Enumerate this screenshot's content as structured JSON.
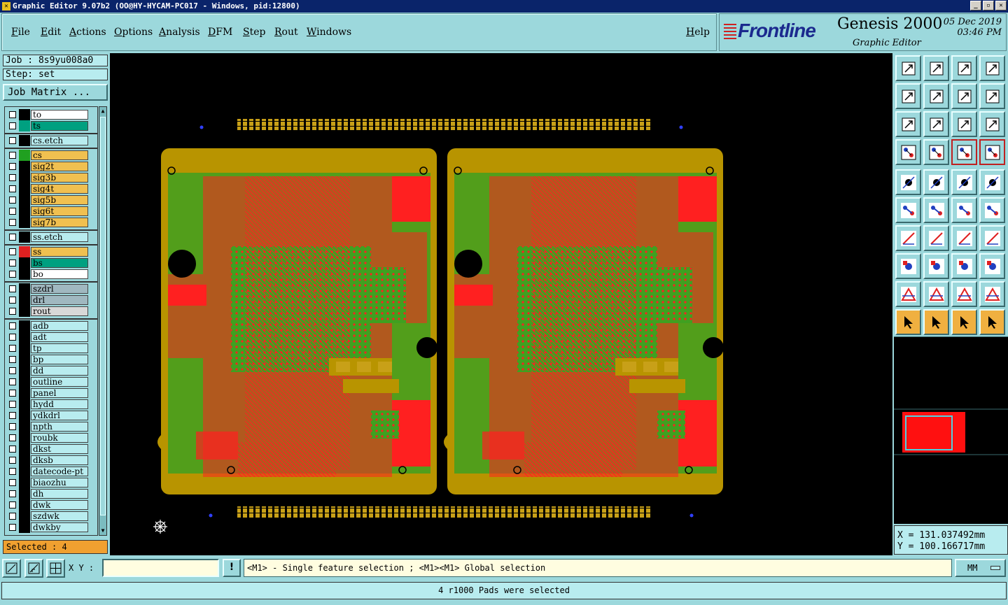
{
  "window": {
    "title": "Graphic Editor 9.07b2 (OO@HY-HYCAM-PC017 - Windows, pid:12800)"
  },
  "menu": [
    {
      "label": "File"
    },
    {
      "label": "Edit"
    },
    {
      "label": "Actions"
    },
    {
      "label": "Options"
    },
    {
      "label": "Analysis"
    },
    {
      "label": "DFM"
    },
    {
      "label": "Step"
    },
    {
      "label": "Rout"
    },
    {
      "label": "Windows"
    },
    {
      "label": "Help"
    }
  ],
  "brand": {
    "logo": "Frontline",
    "product": "Genesis 2000",
    "subtitle": "Graphic Editor",
    "date": "05 Dec 2019",
    "time": "03:46 PM"
  },
  "job": {
    "job_label": "Job : 8s9yu008a0",
    "step_label": "Step: set",
    "matrix_button": "Job Matrix ..."
  },
  "layers": [
    {
      "name": "to",
      "color": "#ffffff"
    },
    {
      "name": "ts",
      "color": "#00a080",
      "mark": "#00a080"
    },
    {
      "name": "cs.etch",
      "color": "#b8ecef"
    },
    {
      "name": "cs",
      "color": "#f0c050",
      "mark": "#20a020"
    },
    {
      "name": "sig2t",
      "color": "#f0c050"
    },
    {
      "name": "sig3b",
      "color": "#f0c050"
    },
    {
      "name": "sig4t",
      "color": "#f0c050"
    },
    {
      "name": "sig5b",
      "color": "#f0c050"
    },
    {
      "name": "sig6t",
      "color": "#f0c050"
    },
    {
      "name": "sig7b",
      "color": "#f0c050"
    },
    {
      "name": "ss.etch",
      "color": "#b8ecef"
    },
    {
      "name": "ss",
      "color": "#f0c050",
      "mark": "#e02020"
    },
    {
      "name": "bs",
      "color": "#00a080"
    },
    {
      "name": "bo",
      "color": "#ffffff"
    },
    {
      "name": "szdrl",
      "color": "#a0b8c0"
    },
    {
      "name": "drl",
      "color": "#a0b8c0"
    },
    {
      "name": "rout",
      "color": "#d8d8d8"
    },
    {
      "name": "adb",
      "color": "#b8ecef"
    },
    {
      "name": "adt",
      "color": "#b8ecef"
    },
    {
      "name": "tp",
      "color": "#b8ecef"
    },
    {
      "name": "bp",
      "color": "#b8ecef"
    },
    {
      "name": "dd",
      "color": "#b8ecef"
    },
    {
      "name": "outline",
      "color": "#b8ecef"
    },
    {
      "name": "panel",
      "color": "#b8ecef"
    },
    {
      "name": "hydd",
      "color": "#b8ecef"
    },
    {
      "name": "ydkdrl",
      "color": "#b8ecef"
    },
    {
      "name": "npth",
      "color": "#b8ecef"
    },
    {
      "name": "roubk",
      "color": "#b8ecef"
    },
    {
      "name": "dkst",
      "color": "#b8ecef"
    },
    {
      "name": "dksb",
      "color": "#b8ecef"
    },
    {
      "name": "datecode-pt",
      "color": "#b8ecef"
    },
    {
      "name": "biaozhu",
      "color": "#b8ecef"
    },
    {
      "name": "dh",
      "color": "#b8ecef"
    },
    {
      "name": "dwk",
      "color": "#b8ecef"
    },
    {
      "name": "szdwk",
      "color": "#b8ecef"
    },
    {
      "name": "dwkby",
      "color": "#b8ecef"
    }
  ],
  "selected_label": "Selected : 4",
  "coords": {
    "x": "X = 131.037492mm",
    "y": "Y = 100.166717mm"
  },
  "bottom": {
    "xy_label": "X Y :",
    "xy_value": "",
    "warn": "!",
    "hint": "<M1> - Single feature selection ; <M1><M1> Global selection",
    "units": "MM"
  },
  "status": "4 r1000 Pads were selected",
  "colors": {
    "board": "#b89400",
    "copper_red": "#ff2020",
    "copper_green": "#40a020",
    "canvas": "#000000",
    "panel_bg": "#9cd8dc"
  }
}
